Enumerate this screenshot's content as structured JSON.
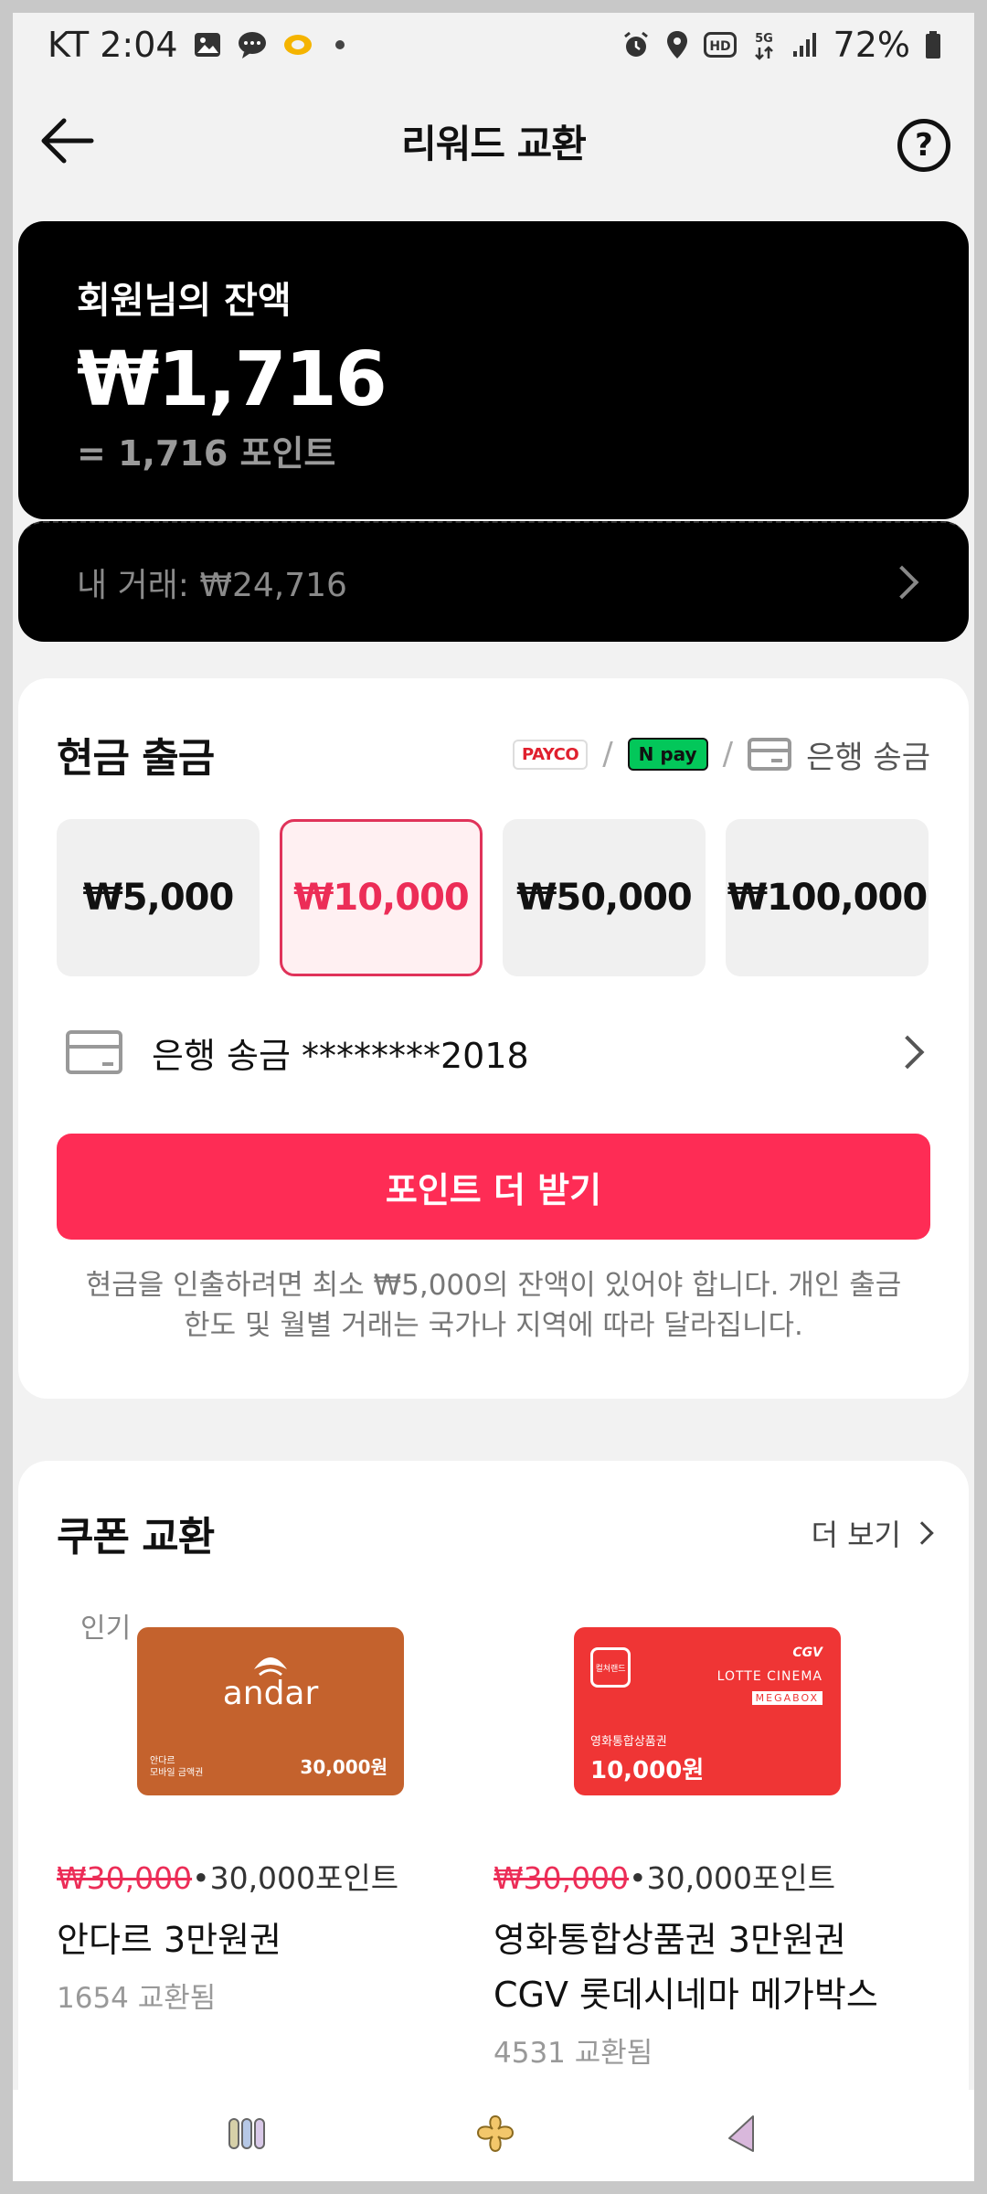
{
  "status_bar": {
    "carrier_time": "KT 2:04",
    "battery": "72%",
    "icons": [
      "gallery-icon",
      "message-icon",
      "app-icon",
      "alarm-icon",
      "location-icon",
      "hd-icon",
      "5g-icon",
      "signal-icon",
      "battery-icon"
    ]
  },
  "header": {
    "title": "리워드 교환",
    "back_icon": "arrow-left-icon",
    "help_icon": "question-circle-icon",
    "help_glyph": "?"
  },
  "balance": {
    "label": "회원님의 잔액",
    "amount": "₩1,716",
    "points": "= 1,716 포인트"
  },
  "trades": {
    "label": "내 거래: ₩24,716"
  },
  "cash_out": {
    "title": "현금 출금",
    "methods": {
      "payco": "PAYCO",
      "npay": "N pay",
      "separator": "/",
      "bank": "은행 송금"
    },
    "amounts": [
      "₩5,000",
      "₩10,000",
      "₩50,000",
      "₩100,000"
    ],
    "selected_index": 1,
    "bank_account": "은행 송금 ********2018",
    "cta": "포인트 더 받기",
    "notice_line1": "현금을 인출하려면 최소 ₩5,000의 잔액이 있어야 합니다. 개인 출금",
    "notice_line2": "한도 및 월별 거래는 국가나 지역에 따라 달라집니다."
  },
  "coupons": {
    "title": "쿠폰 교환",
    "more": "더 보기",
    "items": [
      {
        "badge": "인기",
        "brand_text": "andar",
        "card_sub_line1": "안다르",
        "card_sub_line2": "모바일 금액권",
        "card_value": "30,000원",
        "original_price": "₩30,000",
        "separator": "•",
        "points_price": "30,000포인트",
        "name": "안다르 3만원권",
        "exchanged": "1654 교환됨"
      },
      {
        "badge": "",
        "card_box": "컬쳐랜드",
        "card_brand": "CGV",
        "card_lotte": "LOTTE CINEMA",
        "card_mega": "MEGABOX",
        "card_sub": "영화통합상품권",
        "card_value": "10,000원",
        "original_price": "₩30,000",
        "separator": "•",
        "points_price": "30,000포인트",
        "name_line1": "영화통합상품권 3만원권",
        "name_line2": "CGV 롯데시네마 메가박스",
        "exchanged": "4531 교환됨"
      }
    ]
  },
  "bottom_nav": {
    "items": [
      "menu-bars-icon",
      "home-flower-icon",
      "back-triangle-icon"
    ]
  },
  "colors": {
    "accent": "#fe2c55",
    "selected_text": "#ec2d57",
    "balance_bg": "#000000",
    "andar_card": "#c4622d",
    "cgv_card": "#ef3535",
    "npay_green": "#03c75a"
  }
}
